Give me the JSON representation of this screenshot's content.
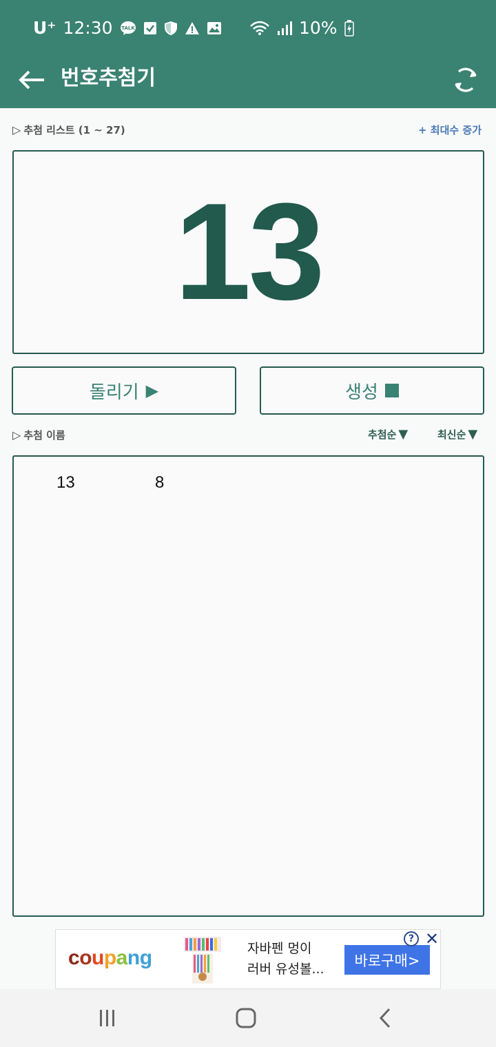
{
  "status_bar": {
    "carrier": "U⁺",
    "time": "12:30",
    "battery": "10%",
    "left_icons": [
      "talk-icon",
      "check-icon",
      "shield-icon",
      "warning-icon",
      "image-icon"
    ],
    "right_icons": [
      "wifi-icon",
      "signal-icon",
      "battery-charging-icon"
    ]
  },
  "app_bar": {
    "title": "번호추첨기"
  },
  "draw_list": {
    "label": "추첨 리스트 (1 ~ 27)",
    "increase_label": "+ 최대수 증가"
  },
  "display": {
    "current_number": "13"
  },
  "buttons": {
    "rotate_label": "돌리기",
    "generate_label": "생성"
  },
  "results": {
    "label": "추첨 이름",
    "sort_draw_label": "추첨순",
    "sort_latest_label": "최신순",
    "items": [
      "13",
      "8"
    ]
  },
  "ad": {
    "brand": "coupang",
    "line1": "자바펜 멍이",
    "line2": "러버 유성볼...",
    "cta": "바로구매>",
    "brand_colors": [
      "#8a2a1a",
      "#a8341f",
      "#e2481f",
      "#f0a22b",
      "#8bbf3c",
      "#3fa0d8",
      "#3fa0d8"
    ]
  },
  "colors": {
    "primary": "#3a8272",
    "dark_accent": "#225a4d",
    "link": "#4a7bb5",
    "cta": "#3f74e6"
  }
}
